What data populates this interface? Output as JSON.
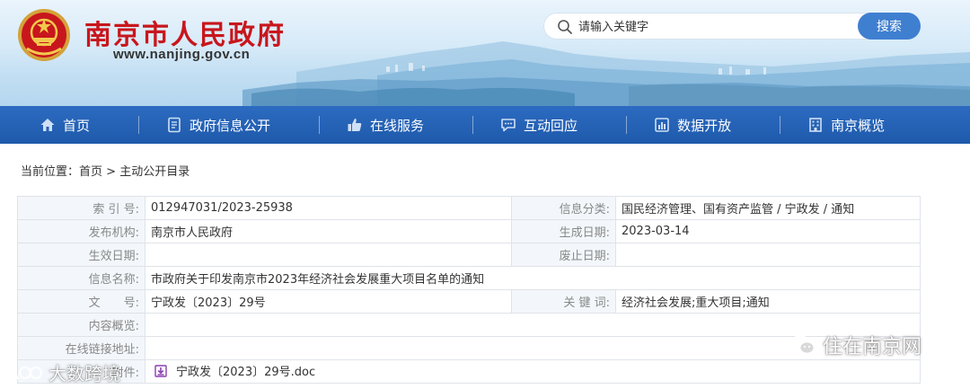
{
  "header": {
    "site_title": "南京市人民政府",
    "site_url": "www.nanjing.gov.cn",
    "search": {
      "placeholder": "请输入关键字",
      "button_label": "搜索"
    }
  },
  "nav": {
    "items": [
      {
        "label": "首页",
        "icon": "home-icon"
      },
      {
        "label": "政府信息公开",
        "icon": "document-icon"
      },
      {
        "label": "在线服务",
        "icon": "thumb-up-icon"
      },
      {
        "label": "互动回应",
        "icon": "chat-icon"
      },
      {
        "label": "数据开放",
        "icon": "data-icon"
      },
      {
        "label": "南京概览",
        "icon": "building-icon"
      }
    ]
  },
  "breadcrumb": {
    "prefix": "当前位置：",
    "home": "首页",
    "separator": " > ",
    "current": "主动公开目录"
  },
  "info": {
    "index_no": {
      "label": "索 引 号:",
      "value": "012947031/2023-25938"
    },
    "category": {
      "label": "信息分类:",
      "value": "国民经济管理、国有资产监管 / 宁政发 / 通知"
    },
    "publisher": {
      "label": "发布机构:",
      "value": "南京市人民政府"
    },
    "created_date": {
      "label": "生成日期:",
      "value": "2023-03-14"
    },
    "effective_date": {
      "label": "生效日期:",
      "value": ""
    },
    "expiry_date": {
      "label": "废止日期:",
      "value": ""
    },
    "title": {
      "label": "信息名称:",
      "value": "市政府关于印发南京市2023年经济社会发展重大项目名单的通知"
    },
    "doc_no": {
      "label": "文　　号:",
      "value": "宁政发〔2023〕29号"
    },
    "keywords": {
      "label": "关 键 词:",
      "value": "经济社会发展;重大项目;通知"
    },
    "summary": {
      "label": "内容概览:",
      "value": ""
    },
    "online_link": {
      "label": "在线链接地址:",
      "value": ""
    },
    "attachment": {
      "label": "附件:",
      "value": "宁政发〔2023〕29号.doc"
    }
  },
  "watermarks": {
    "right": "住在南京网",
    "left": "大数跨境"
  },
  "colors": {
    "nav_blue": "#2563b8",
    "title_red": "#c8161d",
    "search_button": "#3f7fd0",
    "label_bg": "#f3f7fb"
  }
}
